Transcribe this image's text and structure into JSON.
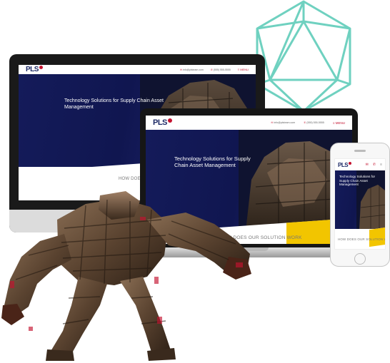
{
  "colors": {
    "accent_teal": "#6fd1c0",
    "brand_navy": "#1d2a66",
    "brand_red": "#c4122f",
    "stripe_gold": "#f2c500"
  },
  "icons": {
    "mail": "mail-icon",
    "phone": "phone-icon",
    "menu": "hamburger-icon"
  },
  "site": {
    "logo": "PLS",
    "email": "info@plsteam.com",
    "phone": "(555) 555-5555",
    "menu_label": "MENU",
    "hero_title": "Technology Solutions for Supply Chain Asset Management",
    "section_heading": "HOW DOES OUR SOLUTION WORK"
  }
}
